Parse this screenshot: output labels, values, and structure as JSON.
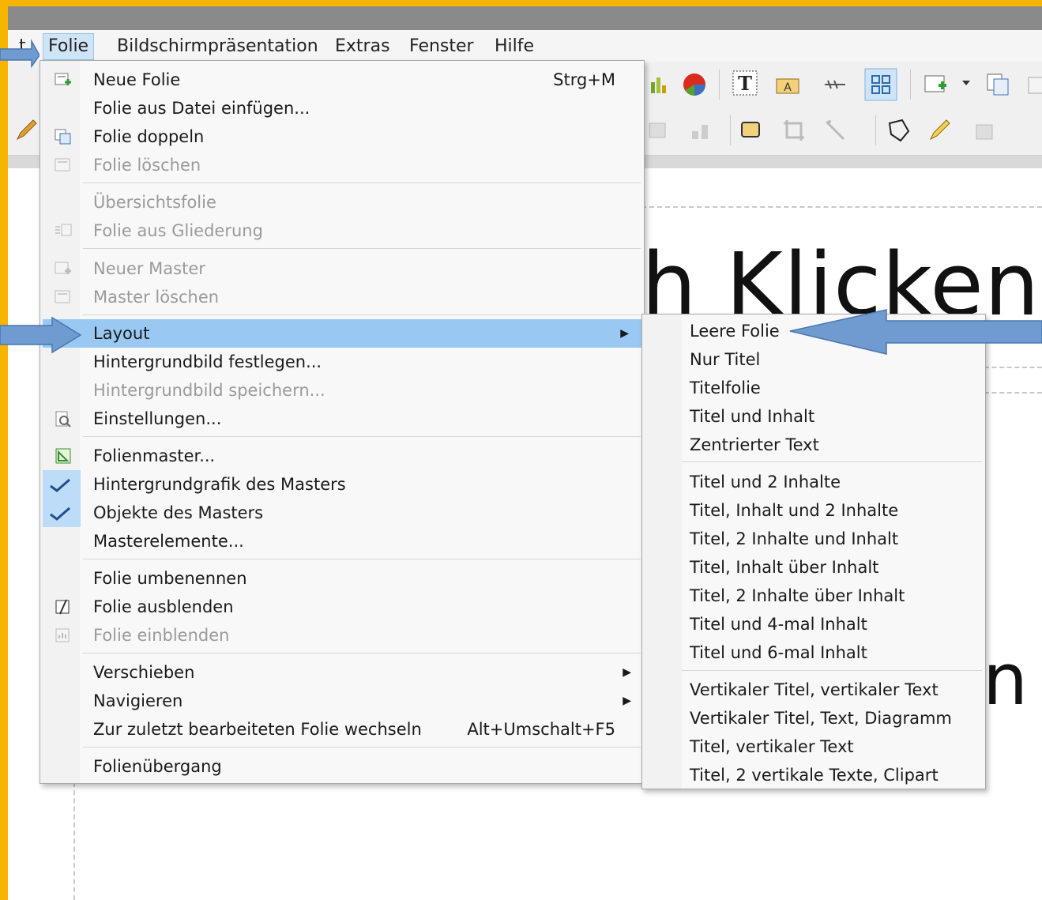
{
  "menubar": {
    "cut_prefix": "t",
    "items": [
      "Folie",
      "Bildschirmpräsentation",
      "Extras",
      "Fenster",
      "Hilfe"
    ]
  },
  "slide": {
    "title_fragment": "h Klicken",
    "body_fragment": "n I"
  },
  "folie_menu": {
    "items": [
      {
        "label": "Neue Folie",
        "shortcut": "Strg+M"
      },
      {
        "label": "Folie aus Datei einfügen..."
      },
      {
        "label": "Folie doppeln"
      },
      {
        "label": "Folie löschen"
      },
      {
        "label": "Übersichtsfolie"
      },
      {
        "label": "Folie aus Gliederung"
      },
      {
        "label": "Neuer Master"
      },
      {
        "label": "Master löschen"
      },
      {
        "label": "Layout"
      },
      {
        "label": "Hintergrundbild festlegen..."
      },
      {
        "label": "Hintergrundbild speichern..."
      },
      {
        "label": "Einstellungen..."
      },
      {
        "label": "Folienmaster..."
      },
      {
        "label": "Hintergrundgrafik des Masters"
      },
      {
        "label": "Objekte des Masters"
      },
      {
        "label": "Masterelemente..."
      },
      {
        "label": "Folie umbenennen"
      },
      {
        "label": "Folie ausblenden"
      },
      {
        "label": "Folie einblenden"
      },
      {
        "label": "Verschieben"
      },
      {
        "label": "Navigieren"
      },
      {
        "label": "Zur zuletzt bearbeiteten Folie wechseln",
        "shortcut": "Alt+Umschalt+F5"
      },
      {
        "label": "Folienübergang"
      }
    ]
  },
  "layout_submenu": {
    "items": [
      "Leere Folie",
      "Nur Titel",
      "Titelfolie",
      "Titel und Inhalt",
      "Zentrierter Text",
      "Titel und 2 Inhalte",
      "Titel, Inhalt und 2 Inhalte",
      "Titel, 2 Inhalte und Inhalt",
      "Titel, Inhalt über Inhalt",
      "Titel, 2 Inhalte über Inhalt",
      "Titel und 4-mal Inhalt",
      "Titel und 6-mal Inhalt",
      "Vertikaler Titel, vertikaler Text",
      "Vertikaler Titel, Text, Diagramm",
      "Titel, vertikaler Text",
      "Titel, 2 vertikale Texte, Clipart"
    ]
  },
  "colors": {
    "frame": "#f7b500",
    "highlight": "#99c9f2",
    "annotation_arrow": "#6f9bd1"
  }
}
